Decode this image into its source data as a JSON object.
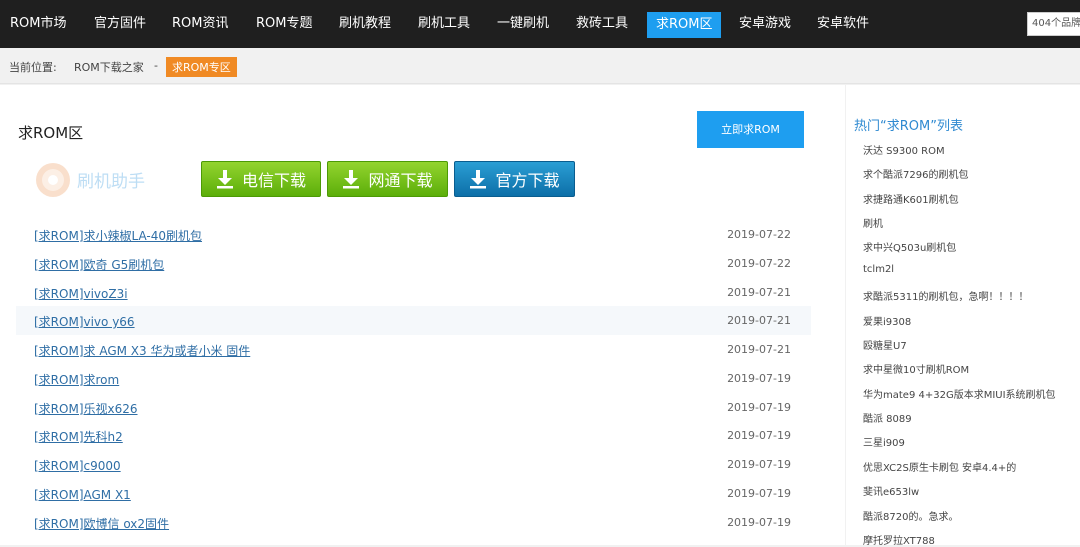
{
  "nav": {
    "items": [
      {
        "label": "ROM市场"
      },
      {
        "label": "官方固件"
      },
      {
        "label": "ROM资讯"
      },
      {
        "label": "ROM专题"
      },
      {
        "label": "刷机教程"
      },
      {
        "label": "刷机工具"
      },
      {
        "label": "一键刷机"
      },
      {
        "label": "救砖工具"
      },
      {
        "label": "求ROM区"
      },
      {
        "label": "安卓游戏"
      },
      {
        "label": "安卓软件"
      }
    ],
    "active_index": 8,
    "search_placeholder": "404个品牌"
  },
  "breadcrumb": {
    "prefix": "当前位置:",
    "home": "ROM下载之家",
    "separator": "-",
    "current": "求ROM专区"
  },
  "main": {
    "title": "求ROM区",
    "request_button": "立即求ROM",
    "logo_text": "刷机助手",
    "downloads": [
      {
        "label": "电信下载"
      },
      {
        "label": "网通下载"
      },
      {
        "label": "官方下载"
      }
    ],
    "list": [
      {
        "title": "[求ROM]求小辣椒LA-40刷机包",
        "date": "2019-07-22"
      },
      {
        "title": "[求ROM]欧奇 G5刷机包",
        "date": "2019-07-22"
      },
      {
        "title": "[求ROM]vivoZ3i",
        "date": "2019-07-21"
      },
      {
        "title": "[求ROM]vivo y66",
        "date": "2019-07-21"
      },
      {
        "title": "[求ROM]求 AGM X3 华为或者小米 固件",
        "date": "2019-07-21"
      },
      {
        "title": "[求ROM]求rom",
        "date": "2019-07-19"
      },
      {
        "title": "[求ROM]乐视x626",
        "date": "2019-07-19"
      },
      {
        "title": "[求ROM]先科h2",
        "date": "2019-07-19"
      },
      {
        "title": "[求ROM]c9000",
        "date": "2019-07-19"
      },
      {
        "title": "[求ROM]AGM X1",
        "date": "2019-07-19"
      },
      {
        "title": "[求ROM]欧博信 ox2固件",
        "date": "2019-07-19"
      }
    ]
  },
  "sidebar": {
    "title": "热门“求ROM”列表",
    "items": [
      "沃达 S9300 ROM",
      "求个酷派7296的刷机包",
      "求捷路通K601刷机包",
      "刷机",
      "求中兴Q503u刷机包",
      "tclm2l",
      "求酷派5311的刷机包，急啊！！！！",
      "爱果i9308",
      "殴糖星U7",
      "求中星微10寸刷机ROM",
      "华为mate9 4+32G版本求MIUI系统刷机包",
      "酷派 8089",
      "三星i909",
      "优思XC2S原生卡刷包 安卓4.4+的",
      "斐讯e653lw",
      "酷派8720的。急求。",
      "摩托罗拉XT788"
    ]
  },
  "colors": {
    "nav_bg": "#1f1f1f",
    "accent": "#1e9ef0",
    "crumb_current": "#f08a24",
    "link": "#2f6ea5",
    "sidebar_title": "#2f8ad1"
  }
}
